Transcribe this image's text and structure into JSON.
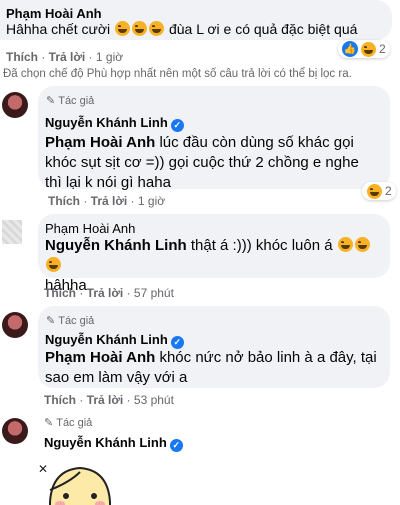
{
  "comments": [
    {
      "name": "Phạm Hoài Anh",
      "text_before": "Hâhha chết cười",
      "text_after": "đùa L ơi e có quả đặc biệt quá",
      "like": "Thích",
      "reply": "Trả lời",
      "time": "1 giờ",
      "reaction_count": "2"
    },
    {
      "author_tag": "Tác giả",
      "name": "Nguyễn Khánh Linh",
      "mention": "Phạm Hoài Anh",
      "text": "lúc đầu còn dùng số khác gọi khóc sụt sịt cơ =)) gọi cuộc thứ 2 chồng e nghe thì lại k nói gì haha",
      "like": "Thích",
      "reply": "Trả lời",
      "time": "1 giờ",
      "reaction_count": "2"
    },
    {
      "name": "Phạm Hoài Anh",
      "mention": "Nguyễn Khánh Linh",
      "text_before": "thật á :))) khóc luôn á",
      "text_after": "hâhha",
      "like": "Thích",
      "reply": "Trả lời",
      "time": "57 phút"
    },
    {
      "author_tag": "Tác giả",
      "name": "Nguyễn Khánh Linh",
      "mention": "Phạm Hoài Anh",
      "text": "khóc nức nở bảo linh à a đây, tại sao em làm vậy với a",
      "like": "Thích",
      "reply": "Trả lời",
      "time": "53 phút"
    },
    {
      "author_tag": "Tác giả",
      "name": "Nguyễn Khánh Linh"
    }
  ],
  "filter_notice": "Đã chọn chế độ Phù hợp nhất nên một số câu trả lời có thể bị lọc ra.",
  "colors": {
    "bubble": "#f0f2f5",
    "like_blue": "#1877f2",
    "meta": "#65676b"
  },
  "icons": {
    "verified": "verified-badge-icon",
    "author": "pen-icon",
    "haha": "haha-emoji"
  }
}
